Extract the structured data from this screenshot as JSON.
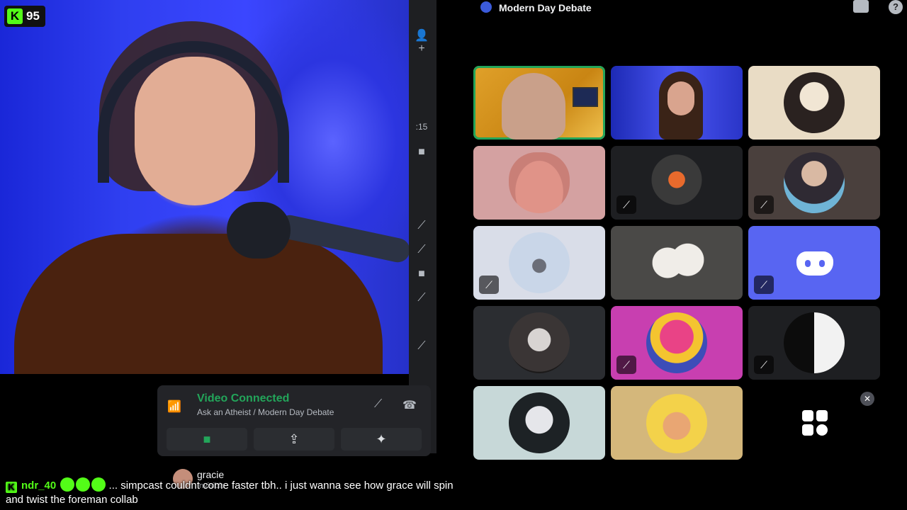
{
  "stream": {
    "viewer_count": "95"
  },
  "header": {
    "title": "Modern Day Debate"
  },
  "strip": {
    "time_fragment": ":15"
  },
  "voice_panel": {
    "status": "Video Connected",
    "subtitle": "Ask an Atheist / Modern Day Debate"
  },
  "user": {
    "name": "gracie",
    "status": "Invisible"
  },
  "chat": {
    "username": "ndr_40",
    "message": "... simpcast couldnt come faster tbh.. i just wanna see how grace will spin and twist the foreman collab"
  },
  "colors": {
    "accent_green": "#23a55a",
    "kick_green": "#53fc18",
    "discord_blurple": "#5865f2"
  }
}
